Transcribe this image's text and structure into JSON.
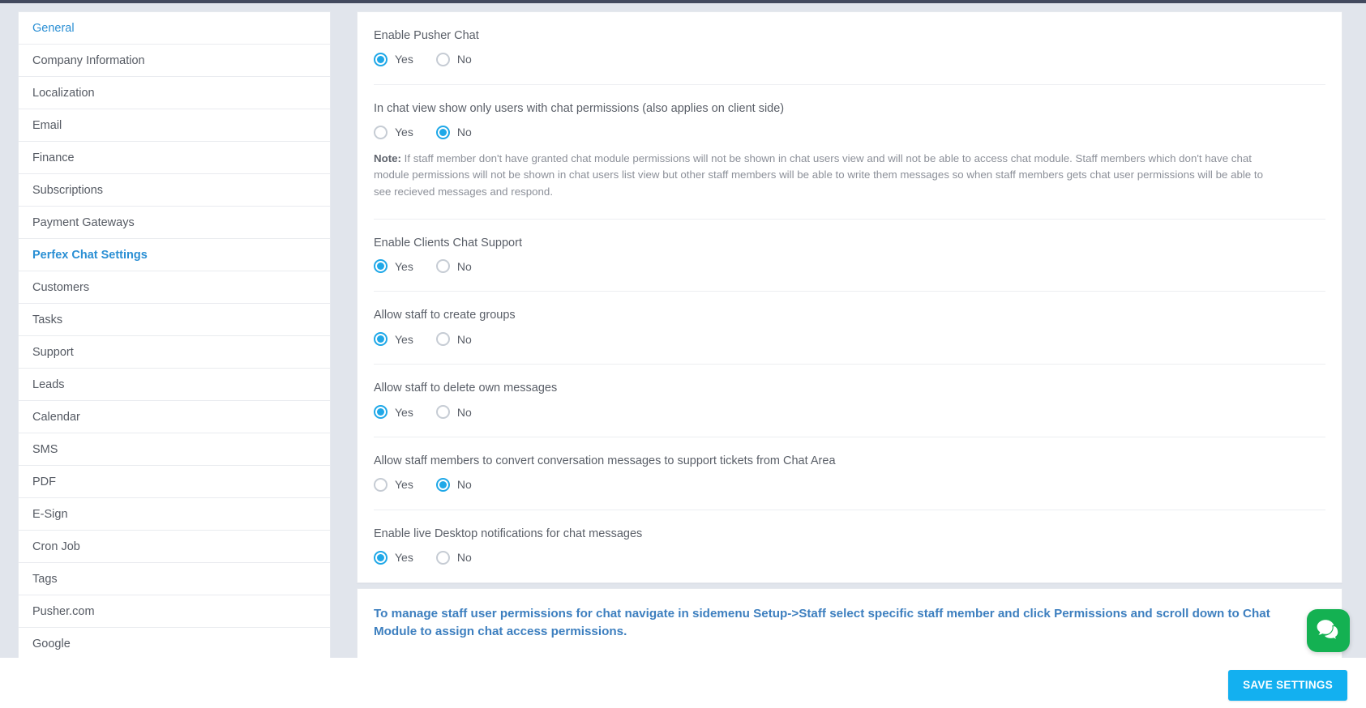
{
  "sidebar": {
    "items": [
      {
        "label": "General",
        "state": "active"
      },
      {
        "label": "Company Information",
        "state": "normal"
      },
      {
        "label": "Localization",
        "state": "normal"
      },
      {
        "label": "Email",
        "state": "normal"
      },
      {
        "label": "Finance",
        "state": "normal"
      },
      {
        "label": "Subscriptions",
        "state": "normal"
      },
      {
        "label": "Payment Gateways",
        "state": "normal"
      },
      {
        "label": "Perfex Chat Settings",
        "state": "brand"
      },
      {
        "label": "Customers",
        "state": "normal"
      },
      {
        "label": "Tasks",
        "state": "normal"
      },
      {
        "label": "Support",
        "state": "normal"
      },
      {
        "label": "Leads",
        "state": "normal"
      },
      {
        "label": "Calendar",
        "state": "normal"
      },
      {
        "label": "SMS",
        "state": "normal"
      },
      {
        "label": "PDF",
        "state": "normal"
      },
      {
        "label": "E-Sign",
        "state": "normal"
      },
      {
        "label": "Cron Job",
        "state": "normal"
      },
      {
        "label": "Tags",
        "state": "normal"
      },
      {
        "label": "Pusher.com",
        "state": "normal"
      },
      {
        "label": "Google",
        "state": "normal"
      }
    ]
  },
  "settings": {
    "groups": [
      {
        "label": "Enable Pusher Chat",
        "options": [
          {
            "label": "Yes",
            "selected": true
          },
          {
            "label": "No",
            "selected": false
          }
        ],
        "note": null
      },
      {
        "label": "In chat view show only users with chat permissions (also applies on client side)",
        "options": [
          {
            "label": "Yes",
            "selected": false
          },
          {
            "label": "No",
            "selected": true
          }
        ],
        "note_prefix": "Note:",
        "note": " If staff member don't have granted chat module permissions will not be shown in chat users view and will not be able to access chat module. Staff members which don't have chat module permissions will not be shown in chat users list view but other staff members will be able to write them messages so when staff members gets chat user permissions will be able to see recieved messages and respond."
      },
      {
        "label": "Enable Clients Chat Support",
        "options": [
          {
            "label": "Yes",
            "selected": true
          },
          {
            "label": "No",
            "selected": false
          }
        ],
        "note": null
      },
      {
        "label": "Allow staff to create groups",
        "options": [
          {
            "label": "Yes",
            "selected": true
          },
          {
            "label": "No",
            "selected": false
          }
        ],
        "note": null
      },
      {
        "label": "Allow staff to delete own messages",
        "options": [
          {
            "label": "Yes",
            "selected": true
          },
          {
            "label": "No",
            "selected": false
          }
        ],
        "note": null
      },
      {
        "label": "Allow staff members to convert conversation messages to support tickets from Chat Area",
        "options": [
          {
            "label": "Yes",
            "selected": false
          },
          {
            "label": "No",
            "selected": true
          }
        ],
        "note": null
      },
      {
        "label": "Enable live Desktop notifications for chat messages",
        "options": [
          {
            "label": "Yes",
            "selected": true
          },
          {
            "label": "No",
            "selected": false
          }
        ],
        "note": null
      }
    ]
  },
  "info_panel": {
    "text": "To manage staff user permissions for chat navigate in sidemenu Setup->Staff select specific staff member and click Permissions and scroll down to Chat Module to assign chat access permissions."
  },
  "footer": {
    "save_label": "SAVE SETTINGS"
  },
  "chat_widget": {
    "icon": "chat-bubbles-icon"
  },
  "colors": {
    "accent": "#13b0f0",
    "radio_on": "#1fa8e8",
    "link": "#3d7fbf",
    "chat_fab": "#14b152",
    "page_bg": "#e1e5ec",
    "topbar": "#434a5e"
  }
}
